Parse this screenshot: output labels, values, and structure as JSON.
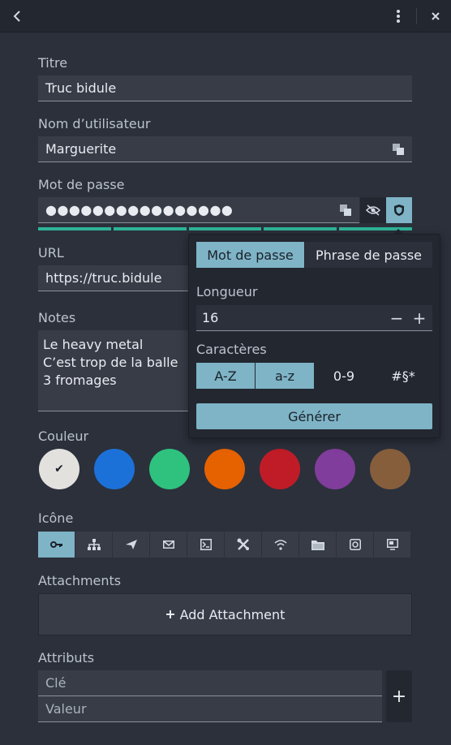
{
  "header": {
    "back_icon": "chevron-left-icon",
    "menu_icon": "kebab-menu-icon",
    "close_icon": "close-icon"
  },
  "fields": {
    "title": {
      "label": "Titre",
      "value": "Truc bidule"
    },
    "username": {
      "label": "Nom d’utilisateur",
      "value": "Marguerite"
    },
    "password": {
      "label": "Mot de passe",
      "value": "●●●●●●●●●●●●●●●●"
    },
    "url": {
      "label": "URL",
      "value": "https://truc.bidule"
    },
    "notes": {
      "label": "Notes",
      "lines": [
        "Le heavy metal",
        "C’est trop de la balle",
        "3 fromages"
      ]
    }
  },
  "password_strength": 1.0,
  "color": {
    "label": "Couleur",
    "options": [
      "#e3e1de",
      "#1c71d8",
      "#2ec27e",
      "#e66100",
      "#c01c28",
      "#813d9c",
      "#865e3c"
    ],
    "selected_index": 0,
    "check": "✔"
  },
  "icon_section": {
    "label": "Icône",
    "icons": [
      "key-icon",
      "network-icon",
      "send-icon",
      "mail-icon",
      "terminal-icon",
      "tools-icon",
      "wifi-icon",
      "folder-icon",
      "safe-icon",
      "computer-icon"
    ],
    "selected_index": 0
  },
  "attachments": {
    "label": "Attachments",
    "add_label": "Add Attachment"
  },
  "attributes": {
    "label": "Attributs",
    "key_placeholder": "Clé",
    "value_placeholder": "Valeur",
    "add_icon": "+"
  },
  "generator": {
    "tabs": [
      "Mot de passe",
      "Phrase de passe"
    ],
    "active_tab": 0,
    "length_label": "Longueur",
    "length_value": "16",
    "minus": "−",
    "plus": "+",
    "chars_label": "Caractères",
    "char_sets": [
      "A-Z",
      "a-z",
      "0-9",
      "#§*"
    ],
    "char_sets_on": [
      true,
      true,
      false,
      false
    ],
    "generate_label": "Générer"
  }
}
